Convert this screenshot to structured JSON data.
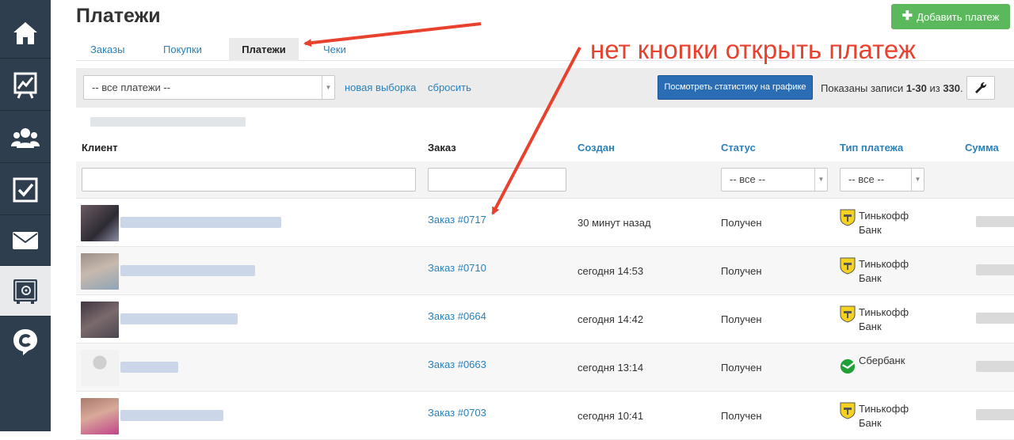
{
  "page": {
    "title": "Платежи"
  },
  "header": {
    "add_button_label": "Добавить платеж"
  },
  "tabs": [
    {
      "label": "Заказы",
      "active": false
    },
    {
      "label": "Покупки",
      "active": false
    },
    {
      "label": "Платежи",
      "active": true
    },
    {
      "label": "Чеки",
      "active": false
    }
  ],
  "filters": {
    "segment_select": "-- все платежи --",
    "new_selection_link": "новая выборка",
    "reset_link": "сбросить",
    "stats_button": "Посмотреть статистику на графике",
    "records_prefix": "Показаны записи ",
    "records_range": "1-30",
    "records_middle": " из ",
    "records_total": "330",
    "records_suffix": "."
  },
  "table": {
    "columns": [
      "Клиент",
      "Заказ",
      "Создан",
      "Статус",
      "Тип платежа",
      "Сумма"
    ],
    "status_filter": "-- все --",
    "type_filter": "-- все --",
    "rows": [
      {
        "order": "Заказ #0717",
        "created": "30 минут назад",
        "status": "Получен",
        "pay_type": "Тинькофф Банк",
        "bank_icon": "tinkoff-icon"
      },
      {
        "order": "Заказ #0710",
        "created": "сегодня 14:53",
        "status": "Получен",
        "pay_type": "Тинькофф Банк",
        "bank_icon": "tinkoff-icon"
      },
      {
        "order": "Заказ #0664",
        "created": "сегодня 14:42",
        "status": "Получен",
        "pay_type": "Тинькофф Банк",
        "bank_icon": "tinkoff-icon"
      },
      {
        "order": "Заказ #0663",
        "created": "сегодня 13:14",
        "status": "Получен",
        "pay_type": "Сбербанк",
        "bank_icon": "sberbank-icon"
      },
      {
        "order": "Заказ #0703",
        "created": "сегодня 10:41",
        "status": "Получен",
        "pay_type": "Тинькофф Банк",
        "bank_icon": "tinkoff-icon"
      }
    ]
  },
  "annotation": {
    "text": "нет кнопки открыть платеж",
    "color": "#e8422f"
  },
  "colors": {
    "sidebar": "#2f3e4e",
    "link": "#2a80b9",
    "add_button": "#5cb85c",
    "stats_button": "#2a6db5"
  },
  "sidebar": {
    "icons": [
      "home-icon",
      "chart-icon",
      "users-icon",
      "tasks-icon",
      "mail-icon",
      "safe-icon",
      "logo-icon"
    ],
    "active": "safe-icon"
  }
}
